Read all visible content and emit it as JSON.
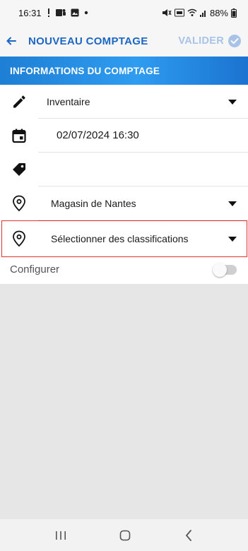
{
  "status_bar": {
    "time": "16:31",
    "battery": "88%"
  },
  "app_bar": {
    "title": "NOUVEAU COMPTAGE",
    "action_label": "VALIDER",
    "action_color": "#a9c3e6",
    "title_color": "#1c66c4"
  },
  "section": {
    "title": "INFORMATIONS DU COMPTAGE"
  },
  "form": {
    "type": {
      "value": "Inventaire",
      "icon": "pencil-icon"
    },
    "date": {
      "value": "02/07/2024 16:30",
      "icon": "calendar-icon"
    },
    "tag": {
      "value": "",
      "icon": "tag-icon"
    },
    "store": {
      "value": "Magasin de Nantes",
      "icon": "location-pin-icon"
    },
    "classification": {
      "value": "Sélectionner des classifications",
      "icon": "location-pin-icon"
    },
    "configure": {
      "label": "Configurer",
      "enabled": false
    }
  }
}
